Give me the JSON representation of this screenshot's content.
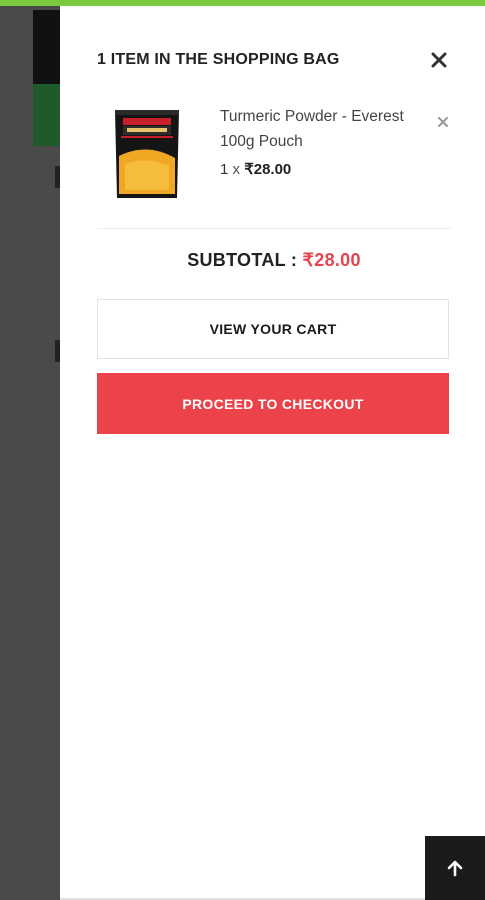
{
  "cart": {
    "title": "1 ITEM IN THE SHOPPING BAG",
    "close_icon": "close-icon",
    "items": [
      {
        "name": "Turmeric Powder - Everest 100g Pouch",
        "quantity": "1",
        "times": "x",
        "price": "₹28.00",
        "thumbnail_icon": "turmeric-pouch-image",
        "remove_icon": "remove-icon"
      }
    ],
    "subtotal_label": "SUBTOTAL :",
    "subtotal_amount": "₹28.00",
    "view_cart_label": "VIEW YOUR CART",
    "checkout_label": "PROCEED TO CHECKOUT"
  },
  "colors": {
    "accent_green": "#7cc940",
    "checkout_red": "#eb4349",
    "price_red": "#e6444f",
    "overlay_gray": "#4a4a4a",
    "scroll_top_bg": "#1b1b1b"
  },
  "scroll_top_icon": "arrow-up-icon"
}
